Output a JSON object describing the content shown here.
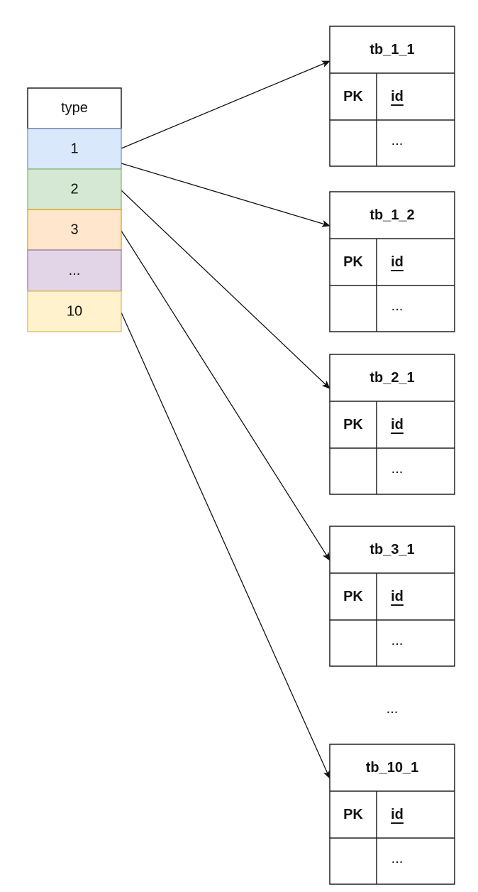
{
  "type_table": {
    "header": "type",
    "rows": [
      {
        "label": "1",
        "fill": "#dae8fc",
        "stroke": "#6c8ebf"
      },
      {
        "label": "2",
        "fill": "#d5e8d4",
        "stroke": "#82b366"
      },
      {
        "label": "3",
        "fill": "#ffe6cc",
        "stroke": "#d79b00"
      },
      {
        "label": "...",
        "fill": "#e1d5e7",
        "stroke": "#9673a6"
      },
      {
        "label": "10",
        "fill": "#fff2cc",
        "stroke": "#d6b656"
      }
    ]
  },
  "tables": [
    {
      "name": "tb_1_1",
      "pk": "PK",
      "field": "id",
      "more": "..."
    },
    {
      "name": "tb_1_2",
      "pk": "PK",
      "field": "id",
      "more": "..."
    },
    {
      "name": "tb_2_1",
      "pk": "PK",
      "field": "id",
      "more": "..."
    },
    {
      "name": "tb_3_1",
      "pk": "PK",
      "field": "id",
      "more": "..."
    },
    {
      "name": "tb_10_1",
      "pk": "PK",
      "field": "id",
      "more": "..."
    }
  ],
  "ellipsis": "...",
  "edges": [
    {
      "from": "1",
      "to": "tb_1_1"
    },
    {
      "from": "1",
      "to": "tb_1_2"
    },
    {
      "from": "2",
      "to": "tb_2_1"
    },
    {
      "from": "3",
      "to": "tb_3_1"
    },
    {
      "from": "10",
      "to": "tb_10_1"
    }
  ]
}
